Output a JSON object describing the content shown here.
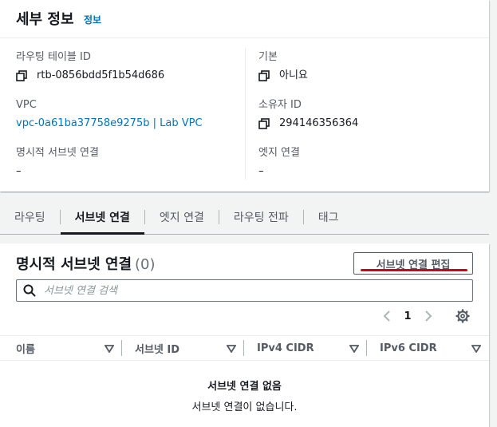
{
  "details": {
    "title": "세부 정보",
    "info_link": "정보",
    "fields_left": [
      {
        "label": "라우팅 테이블 ID",
        "value": "rtb-0856bdd5f1b54d686",
        "copyable": true,
        "link": false
      },
      {
        "label": "VPC",
        "value": "vpc-0a61ba37758e9275b | Lab VPC",
        "copyable": false,
        "link": true
      },
      {
        "label": "명시적 서브넷 연결",
        "value": "–",
        "copyable": false,
        "link": false
      }
    ],
    "fields_right": [
      {
        "label": "기본",
        "value": "아니요",
        "copyable": true,
        "link": false
      },
      {
        "label": "소유자 ID",
        "value": "294146356364",
        "copyable": true,
        "link": false
      },
      {
        "label": "엣지 연결",
        "value": "–",
        "copyable": false,
        "link": false
      }
    ]
  },
  "tabs": [
    {
      "label": "라우팅",
      "active": false
    },
    {
      "label": "서브넷 연결",
      "active": true
    },
    {
      "label": "엣지 연결",
      "active": false
    },
    {
      "label": "라우팅 전파",
      "active": false
    },
    {
      "label": "태그",
      "active": false
    }
  ],
  "table": {
    "title": "명시적 서브넷 연결",
    "count": "(0)",
    "edit_button": "서브넷 연결 편집",
    "search_placeholder": "서브넷 연결 검색",
    "page": "1",
    "columns": [
      "이름",
      "서브넷 ID",
      "IPv4 CIDR",
      "IPv6 CIDR"
    ],
    "empty_title": "서브넷 연결 없음",
    "empty_desc": "서브넷 연결이 없습니다."
  },
  "icons": {
    "copy": "copy-icon",
    "search": "search-icon",
    "gear": "gear-icon",
    "sort": "caret-down-icon",
    "prev": "chevron-left-icon",
    "next": "chevron-right-icon"
  },
  "colors": {
    "link": "#0073bb",
    "text": "#16191f",
    "secondary": "#545b64",
    "annotation": "#d0021b"
  }
}
